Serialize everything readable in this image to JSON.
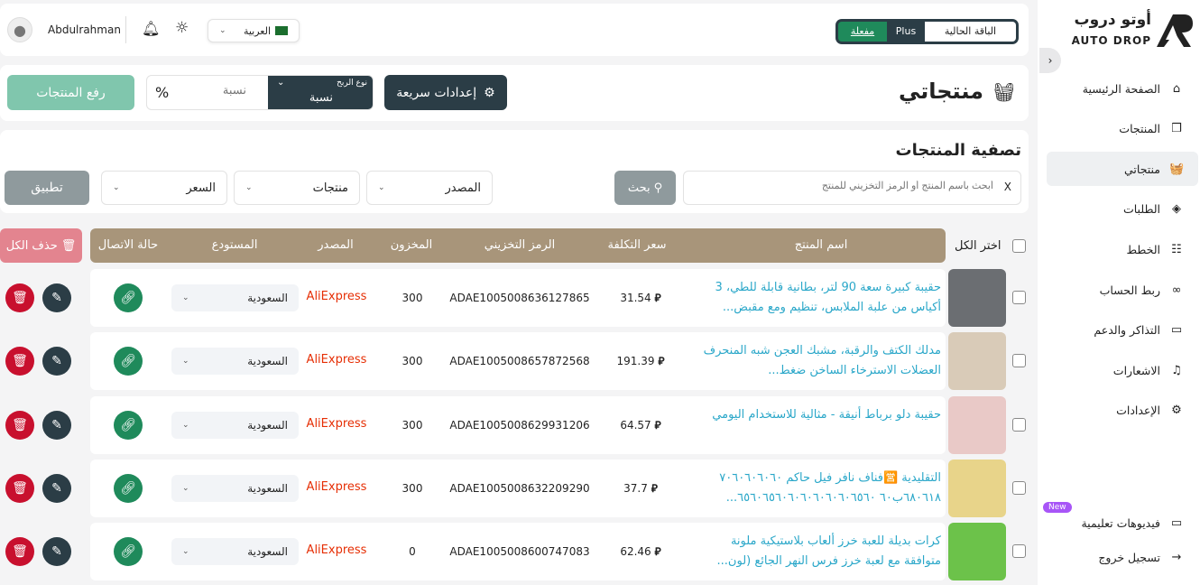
{
  "sidebar": {
    "logo_ar": "أوتو دروب",
    "logo_en": "AUTO DROP",
    "collapse": "›",
    "items": [
      {
        "label": "الصفحة الرئيسية",
        "icon": "home-icon",
        "g": "⌂"
      },
      {
        "label": "المنتجات",
        "icon": "box-icon",
        "g": "❒"
      },
      {
        "label": "منتجاتي",
        "icon": "basket-icon",
        "g": "🧺"
      },
      {
        "label": "الطلبات",
        "icon": "layers-icon",
        "g": "◈"
      },
      {
        "label": "الخطط",
        "icon": "plan-icon",
        "g": "☷"
      },
      {
        "label": "ربط الحساب",
        "icon": "link-icon",
        "g": "∞"
      },
      {
        "label": "التذاكر والدعم",
        "icon": "ticket-icon",
        "g": "▭"
      },
      {
        "label": "الاشعارات",
        "icon": "bell-icon",
        "g": "♫"
      },
      {
        "label": "الإعدادات",
        "icon": "gear-icon",
        "g": "⚙"
      }
    ],
    "videos": "فيديوهات تعليمية",
    "new_badge": "New",
    "logout": "تسجيل خروج"
  },
  "topbar": {
    "user": "Abdulrahman",
    "language": "العربية",
    "plan_label": "الباقة الحالية",
    "plan_name": "Plus",
    "plan_status": "مفعلة"
  },
  "page": {
    "title": "منتجاتي",
    "quick_settings": "إعدادات سريعة",
    "profit_type_label": "نوع الربح",
    "profit_type_value": "نسبة",
    "ratio_placeholder": "نسبة",
    "percent": "%",
    "upload": "رفع المنتجات"
  },
  "filter": {
    "title": "تصفية المنتجات",
    "search_placeholder": "أبحث باسم المنتج أو الرمز التخزيني للمنتج",
    "clear": "X",
    "search_btn": "بحث",
    "source": "المصدر",
    "products": "منتجات",
    "price": "السعر",
    "apply": "تطبيق"
  },
  "table": {
    "select_all": "اختر الكل",
    "headers": {
      "name": "اسم المنتج",
      "cost": "سعر التكلفة",
      "sku": "الرمز التخزيني",
      "stock": "المخزون",
      "source": "المصدر",
      "warehouse": "المستودع",
      "status": "حالة الاتصال"
    },
    "delete_all": "حذف الكل",
    "currency": "⃁",
    "rows": [
      {
        "name": "حقيبة كبيرة سعة 90 لتر، بطانية قابلة للطي، 3 أكياس من علبة الملابس، تنظيم ومع مقبض...",
        "cost": "31.54",
        "sku": "ADAE1005008636127865",
        "stock": "300",
        "source": "AliExpress",
        "warehouse": "السعودية",
        "img": "#6b6e72"
      },
      {
        "name": "مدلك الكتف والرقبة، مشبك العجن شبه المنحرف العضلات الاسترخاء الساخن ضغط...",
        "cost": "191.39",
        "sku": "ADAE1005008657872568",
        "stock": "300",
        "source": "AliExpress",
        "warehouse": "السعودية",
        "img": "#d9cbb8"
      },
      {
        "name": "حقيبة دلو برباط أنيقة - مثالية للاستخدام اليومي",
        "cost": "64.57",
        "sku": "ADAE1005008629931206",
        "stock": "300",
        "source": "AliExpress",
        "warehouse": "السعودية",
        "img": "#e9c9c7"
      },
      {
        "name": "التقليدية 🈺فناف نافر فيل حاكم ٧٠٦٠٦٠٦٠٦٠ ٦٨٠٦١٨ب٦٠ ٦٥٦٠٦٥٦٠٦٠٦٠٦٠٦٠٦٠٦٥٦٠...",
        "cost": "37.7",
        "sku": "ADAE1005008632209290",
        "stock": "300",
        "source": "AliExpress",
        "warehouse": "السعودية",
        "img": "#e8d48a"
      },
      {
        "name": "كرات بديلة للعبة خرز ألعاب بلاستيكية ملونة متوافقة مع لعبة خرز فرس النهر الجائع (لون...",
        "cost": "62.46",
        "sku": "ADAE1005008600747083",
        "stock": "0",
        "source": "AliExpress",
        "warehouse": "السعودية",
        "img": "#6cc24a"
      }
    ]
  },
  "colors": {
    "dark": "#2b3d46",
    "green": "#1f8a5b",
    "red": "#c8102e",
    "header": "#a8957a",
    "link": "#2aa7c9",
    "upload": "#80c6ad"
  }
}
